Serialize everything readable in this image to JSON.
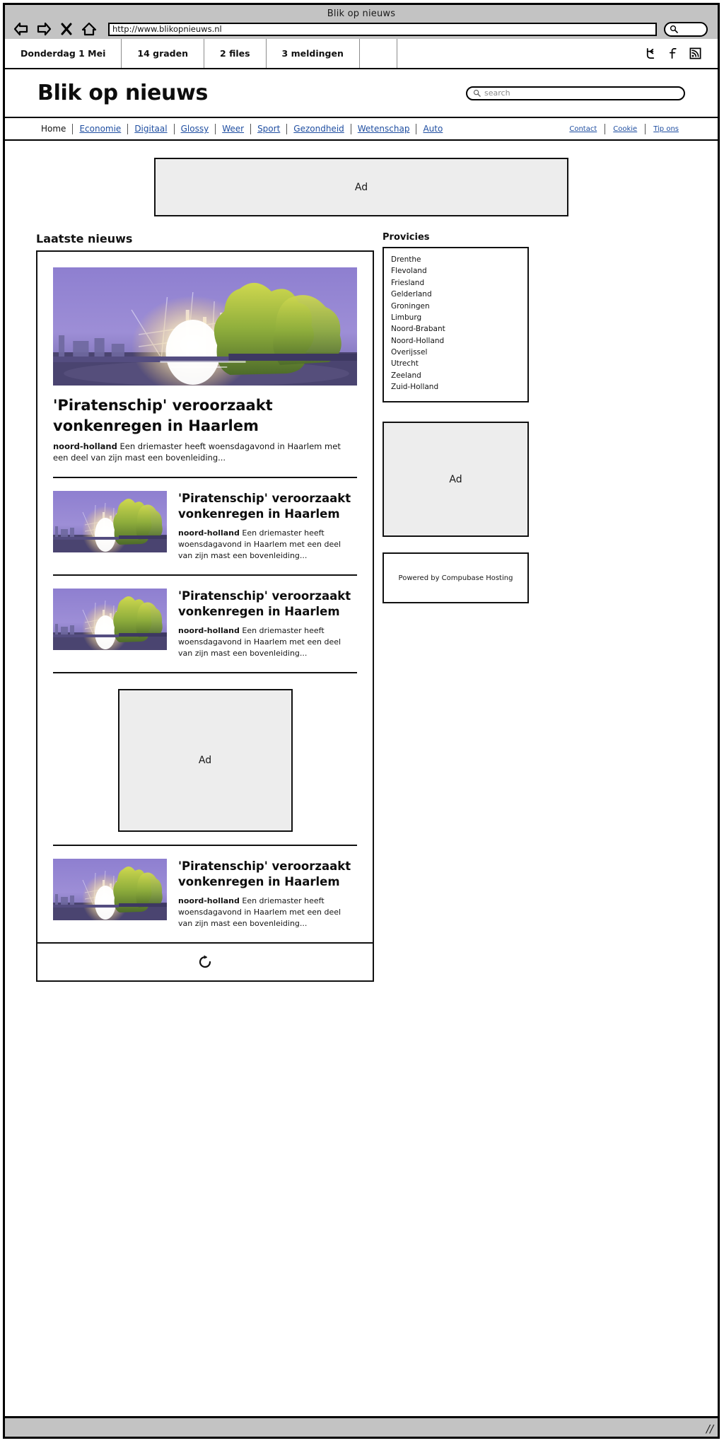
{
  "browser": {
    "window_title": "Blik op nieuws",
    "url": "http://www.blikopnieuws.nl",
    "back_icon": "back-arrow-icon",
    "forward_icon": "forward-arrow-icon",
    "stop_icon": "stop-close-icon",
    "home_icon": "home-icon",
    "toolbar_search_icon": "magnifier-icon"
  },
  "infobar": {
    "items": [
      {
        "label": "Donderdag 1 Mei"
      },
      {
        "label": "14 graden"
      },
      {
        "label": "2 files"
      },
      {
        "label": "3 meldingen"
      }
    ],
    "social": [
      {
        "name": "twitter-icon",
        "label": "Twitter"
      },
      {
        "name": "facebook-icon",
        "label": "Facebook"
      },
      {
        "name": "rss-icon",
        "label": "RSS"
      }
    ]
  },
  "masthead": {
    "logo": "Blik op nieuws",
    "search_placeholder": "search",
    "search_value": "",
    "search_icon": "magnifier-icon"
  },
  "nav": {
    "primary": [
      {
        "label": "Home",
        "current": true
      },
      {
        "label": "Economie",
        "current": false
      },
      {
        "label": "Digitaal",
        "current": false
      },
      {
        "label": "Glossy",
        "current": false
      },
      {
        "label": "Weer",
        "current": false
      },
      {
        "label": "Sport",
        "current": false
      },
      {
        "label": "Gezondheid",
        "current": false
      },
      {
        "label": "Wetenschap",
        "current": false
      },
      {
        "label": "Auto",
        "current": false
      }
    ],
    "secondary": [
      {
        "label": "Contact"
      },
      {
        "label": "Cookie"
      },
      {
        "label": "Tip ons"
      }
    ],
    "link_color": "#1f4ea1"
  },
  "ads": {
    "banner_label": "Ad",
    "inline_label": "Ad",
    "sidebar_label": "Ad",
    "fill_color": "#ededed"
  },
  "main": {
    "section_title": "Laatste nieuws",
    "lead": {
      "title": "'Piratenschip' veroorzaakt vonkenregen in Haarlem",
      "tag": "noord-holland",
      "summary": "Een driemaster heeft woensdagavond in Haarlem met een deel van zijn mast een bovenleiding...",
      "image_alt": "piratenschip-vonkenregen-photo"
    },
    "items": [
      {
        "title": "'Piratenschip' veroorzaakt vonkenregen in Haarlem",
        "tag": "noord-holland",
        "summary": "Een driemaster heeft woensdagavond in Haarlem met een deel van zijn mast een bovenleiding...",
        "image_alt": "piratenschip-vonkenregen-photo"
      },
      {
        "title": "'Piratenschip' veroorzaakt vonkenregen in Haarlem",
        "tag": "noord-holland",
        "summary": "Een driemaster heeft woensdagavond in Haarlem met een deel van zijn mast een bovenleiding...",
        "image_alt": "piratenschip-vonkenregen-photo"
      },
      {
        "title": "'Piratenschip' veroorzaakt vonkenregen in Haarlem",
        "tag": "noord-holland",
        "summary": "Een driemaster heeft woensdagavond in Haarlem met een deel van zijn mast een bovenleiding...",
        "image_alt": "piratenschip-vonkenregen-photo"
      }
    ],
    "load_more_icon": "refresh-icon"
  },
  "sidebar": {
    "provinces_title": "Provicies",
    "provinces": [
      "Drenthe",
      "Flevoland",
      "Friesland",
      "Gelderland",
      "Groningen",
      "Limburg",
      "Noord-Brabant",
      "Noord-Holland",
      "Overijssel",
      "Utrecht",
      "Zeeland",
      "Zuid-Holland"
    ],
    "hosting_credit": "Powered by Compubase Hosting"
  }
}
